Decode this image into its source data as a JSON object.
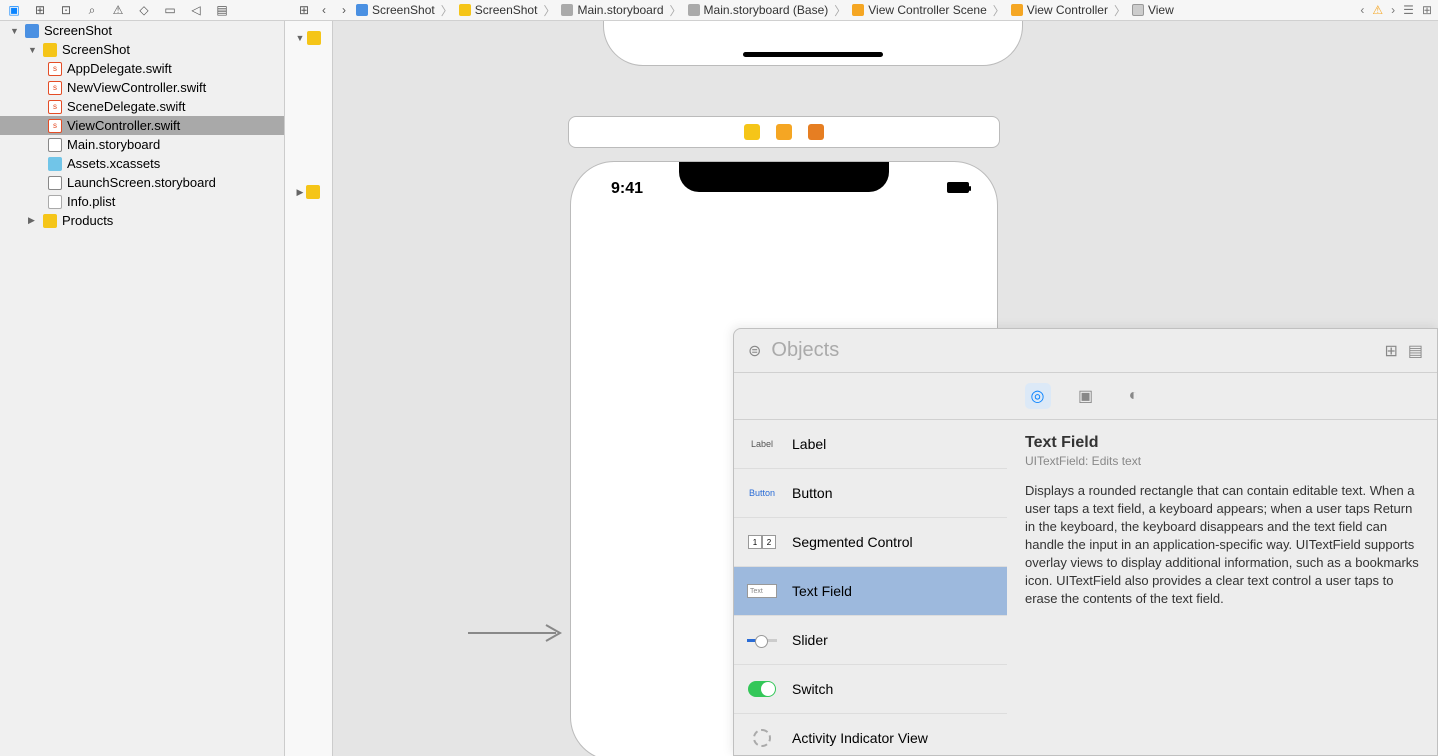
{
  "toolbar": {
    "icons": [
      "folder-icon",
      "version-icon",
      "hierarchy-icon",
      "search-icon",
      "warning-icon",
      "diamond-icon",
      "tag-icon",
      "chat-icon",
      "list-icon"
    ]
  },
  "breadcrumb": [
    {
      "icon": "blue-doc",
      "label": "ScreenShot"
    },
    {
      "icon": "yellow-folder",
      "label": "ScreenShot"
    },
    {
      "icon": "gray-doc",
      "label": "Main.storyboard"
    },
    {
      "icon": "gray-doc",
      "label": "Main.storyboard (Base)"
    },
    {
      "icon": "orange-doc",
      "label": "View Controller Scene"
    },
    {
      "icon": "orange-doc",
      "label": "View Controller"
    },
    {
      "icon": "lightgray-doc",
      "label": "View"
    }
  ],
  "navigator": [
    {
      "indent": 0,
      "chev": "▼",
      "type": "proj",
      "label": "ScreenShot"
    },
    {
      "indent": 1,
      "chev": "▼",
      "type": "folder",
      "label": "ScreenShot"
    },
    {
      "indent": 2,
      "type": "swift",
      "label": "AppDelegate.swift"
    },
    {
      "indent": 2,
      "type": "swift",
      "label": "NewViewController.swift"
    },
    {
      "indent": 2,
      "type": "swift",
      "label": "SceneDelegate.swift"
    },
    {
      "indent": 2,
      "type": "swift",
      "label": "ViewController.swift",
      "highlight": true
    },
    {
      "indent": 2,
      "type": "sb",
      "label": "Main.storyboard"
    },
    {
      "indent": 2,
      "type": "assets",
      "label": "Assets.xcassets"
    },
    {
      "indent": 2,
      "type": "sb",
      "label": "LaunchScreen.storyboard"
    },
    {
      "indent": 2,
      "type": "plist",
      "label": "Info.plist"
    },
    {
      "indent": 1,
      "chev": "▶",
      "type": "folder",
      "label": "Products"
    }
  ],
  "phone": {
    "time": "9:41"
  },
  "library": {
    "search_placeholder": "Objects",
    "items": [
      {
        "preview": "label",
        "name": "Label"
      },
      {
        "preview": "button",
        "name": "Button"
      },
      {
        "preview": "seg",
        "name": "Segmented Control"
      },
      {
        "preview": "text",
        "name": "Text Field",
        "selected": true
      },
      {
        "preview": "slider",
        "name": "Slider"
      },
      {
        "preview": "switch",
        "name": "Switch"
      },
      {
        "preview": "spinner",
        "name": "Activity Indicator View"
      }
    ],
    "detail": {
      "title": "Text Field",
      "subtitle": "UITextField: Edits text",
      "description": "Displays a rounded rectangle that can contain editable text. When a user taps a text field, a keyboard appears; when a user taps Return in the keyboard, the keyboard disappears and the text field can handle the input in an application-specific way. UITextField supports overlay views to display additional information, such as a bookmarks icon. UITextField also provides a clear text control a user taps to erase the contents of the text field."
    }
  }
}
